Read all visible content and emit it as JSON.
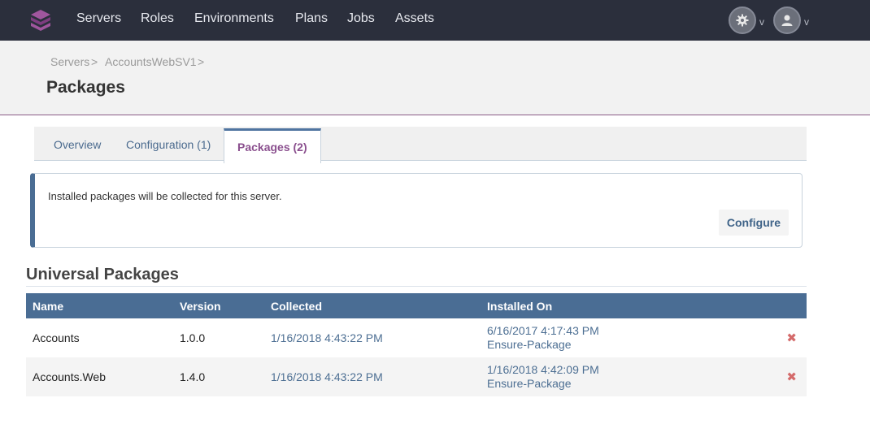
{
  "nav": {
    "items": [
      {
        "label": "Servers"
      },
      {
        "label": "Roles"
      },
      {
        "label": "Environments"
      },
      {
        "label": "Plans"
      },
      {
        "label": "Jobs"
      },
      {
        "label": "Assets"
      }
    ],
    "settings_icon": "gear-icon",
    "user_icon": "user-icon",
    "caret": "v"
  },
  "breadcrumb": {
    "items": [
      {
        "label": "Servers"
      },
      {
        "label": "AccountsWebSV1"
      }
    ],
    "separator": ">"
  },
  "page": {
    "title": "Packages"
  },
  "tabs": [
    {
      "label": "Overview",
      "active": false
    },
    {
      "label": "Configuration (1)",
      "active": false
    },
    {
      "label": "Packages (2)",
      "active": true
    }
  ],
  "info": {
    "message": "Installed packages will be collected for this server.",
    "configure_label": "Configure"
  },
  "section": {
    "title": "Universal Packages"
  },
  "table": {
    "columns": [
      "Name",
      "Version",
      "Collected",
      "Installed On"
    ],
    "rows": [
      {
        "name": "Accounts",
        "version": "1.0.0",
        "collected": "1/16/2018 4:43:22 PM",
        "installed_date": "6/16/2017 4:17:43 PM",
        "installed_by": "Ensure-Package",
        "delete": "✖"
      },
      {
        "name": "Accounts.Web",
        "version": "1.4.0",
        "collected": "1/16/2018 4:43:22 PM",
        "installed_date": "1/16/2018 4:42:09 PM",
        "installed_by": "Ensure-Package",
        "delete": "✖"
      }
    ]
  },
  "colors": {
    "navbar": "#2b2f3c",
    "accent": "#4a6d94",
    "active_tab_text": "#8a4f8e",
    "delete": "#d46a6a"
  }
}
